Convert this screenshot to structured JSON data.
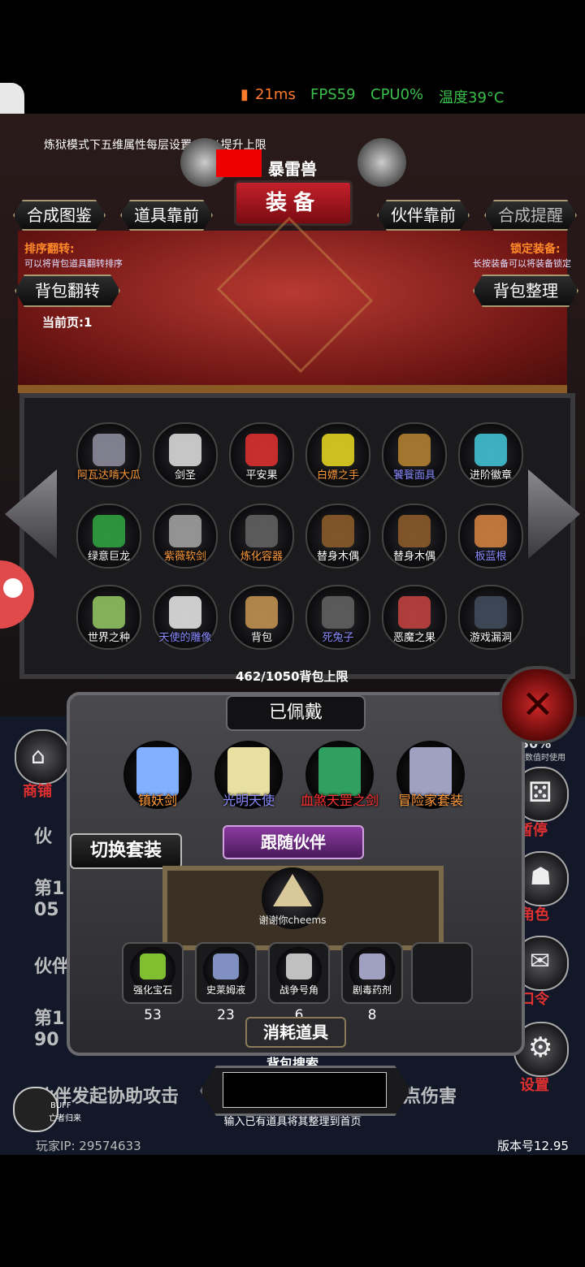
{
  "status_bar": {
    "latency": "21ms",
    "fps": "FPS59",
    "cpu": "CPU0%",
    "temperature": "温度39°C"
  },
  "notice": "炼狱模式下五维属性每层设置0.5%提升上限",
  "player_name": "暴雷兽",
  "screen_title": "装备",
  "top_tabs": [
    "合成图鉴",
    "道具靠前",
    "伙伴靠前",
    "合成提醒"
  ],
  "sort_flip": {
    "title": "排序翻转:",
    "desc": "可以将背包道具翻转排序",
    "button": "背包翻转"
  },
  "lock_equip": {
    "title": "锁定装备:",
    "desc": "长按装备可以将装备锁定",
    "button": "背包整理"
  },
  "current_page": "当前页:1",
  "inventory": [
    {
      "name": "阿瓦达啃大瓜",
      "color": "#ff9a3a",
      "pic": "#8a8a9a"
    },
    {
      "name": "剑圣",
      "color": "#ffffff",
      "pic": "#d8d8d8"
    },
    {
      "name": "平安果",
      "color": "#ffffff",
      "pic": "#d83030"
    },
    {
      "name": "白嫖之手",
      "color": "#ff9a3a",
      "pic": "#e0d020"
    },
    {
      "name": "饕餮面具",
      "color": "#8a8aff",
      "pic": "#b08030"
    },
    {
      "name": "进阶徽章",
      "color": "#ffffff",
      "pic": "#40c0d0"
    },
    {
      "name": "绿意巨龙",
      "color": "#ffffff",
      "pic": "#30a040"
    },
    {
      "name": "紫薇软剑",
      "color": "#ff9a3a",
      "pic": "#a0a0a0"
    },
    {
      "name": "炼化容器",
      "color": "#ff9a3a",
      "pic": "#606060"
    },
    {
      "name": "替身木偶",
      "color": "#ffffff",
      "pic": "#8a5a2a"
    },
    {
      "name": "替身木偶",
      "color": "#ffffff",
      "pic": "#8a5a2a"
    },
    {
      "name": "板蓝根",
      "color": "#8a8aff",
      "pic": "#d08040"
    },
    {
      "name": "世界之种",
      "color": "#ffffff",
      "pic": "#90c060"
    },
    {
      "name": "天使的雕像",
      "color": "#8a8aff",
      "pic": "#e0e0e0"
    },
    {
      "name": "背包",
      "color": "#ffffff",
      "pic": "#c09050"
    },
    {
      "name": "死兔子",
      "color": "#8a8aff",
      "pic": "#606060"
    },
    {
      "name": "恶魔之果",
      "color": "#ffffff",
      "pic": "#c04040"
    },
    {
      "name": "游戏漏洞",
      "color": "#ffffff",
      "pic": "#404a5a"
    }
  ],
  "capacity": "462/1050背包上限",
  "equipped_title": "已佩戴",
  "equipped": [
    {
      "name": "镇妖剑",
      "color": "#ff9a3a",
      "pic": "#80b0ff"
    },
    {
      "name": "光明天使",
      "color": "#8a8aff",
      "pic": "#e8e0a0"
    },
    {
      "name": "血煞天罡之剑",
      "color": "#ff3030",
      "pic": "#30a060"
    },
    {
      "name": "冒险家套装",
      "color": "#ff9a3a",
      "pic": "#a0a0c0"
    }
  ],
  "switch_set": "切换套装",
  "follow_companion": "跟随伙伴",
  "companion_name": "谢谢你cheems",
  "consumables_title": "消耗道具",
  "consumables": [
    {
      "name": "强化宝石",
      "qty": "53",
      "pic": "#80c030"
    },
    {
      "name": "史莱姆液",
      "qty": "23",
      "pic": "#8090c0"
    },
    {
      "name": "战争号角",
      "qty": "6",
      "pic": "#c0c0c0"
    },
    {
      "name": "剧毒药剂",
      "qty": "8",
      "pic": "#a0a0c0"
    }
  ],
  "search_title": "背包搜索",
  "search_hint": "输入已有道具将其整理到首页",
  "side_menu": {
    "shop": "商铺",
    "pause": "暂停",
    "role": "角色",
    "code": "口令",
    "settings": "设置"
  },
  "bg_texts": {
    "companion": "伙",
    "line1": "第1",
    "line2": "05",
    "companion2": "伙伴",
    "line3": "第1",
    "line4": "90",
    "assist_left": "伙伴发起协助攻击",
    "assist_right": "点伤害",
    "pct": "30%",
    "pct_sub": "其数值时使用"
  },
  "buff": {
    "title": "BUFF",
    "sub": "亡者归来"
  },
  "footer": {
    "player_ip": "玩家IP:  29574633",
    "version": "版本号12.95"
  }
}
